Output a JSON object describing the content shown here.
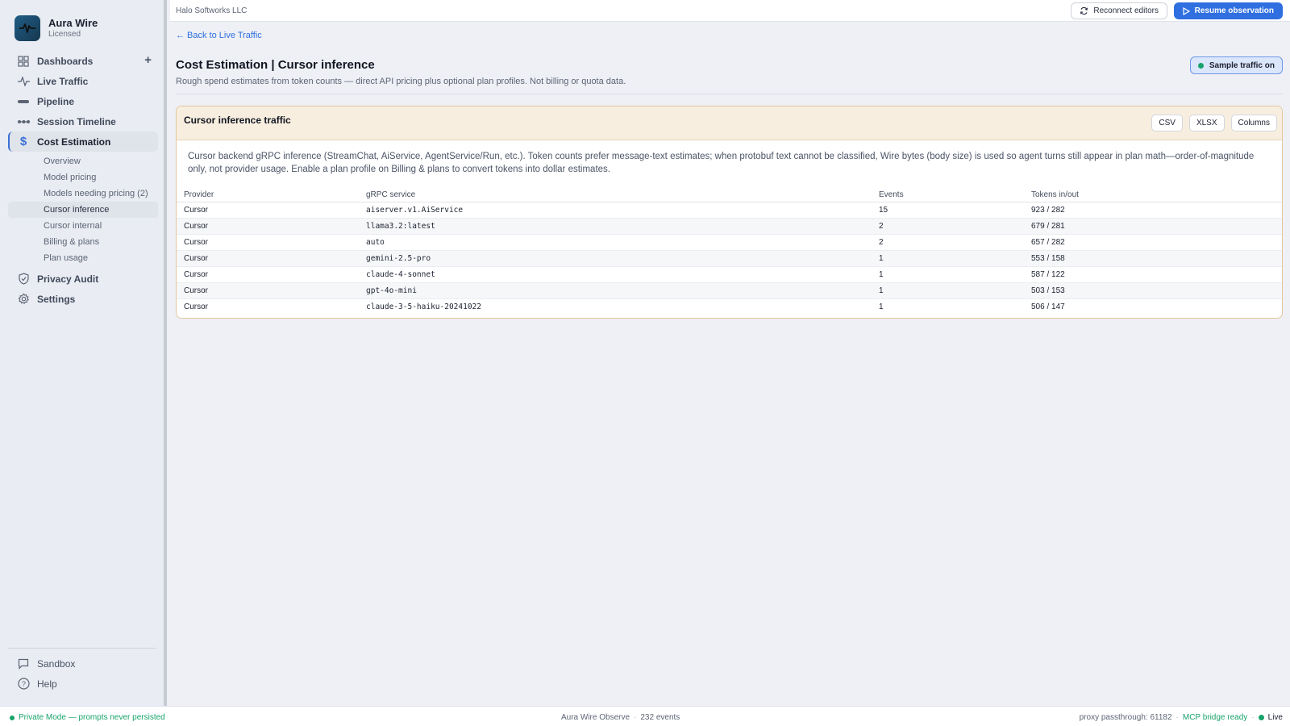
{
  "brand": {
    "name": "Aura Wire",
    "subtitle": "Licensed"
  },
  "sidebar": {
    "items": [
      {
        "label": "Dashboards",
        "icon": "grid-icon"
      },
      {
        "label": "Live Traffic",
        "icon": "activity-icon"
      },
      {
        "label": "Pipeline",
        "icon": "pipeline-icon"
      },
      {
        "label": "Session Timeline",
        "icon": "timeline-icon"
      },
      {
        "label": "Cost Estimation",
        "icon": "dollar-icon",
        "active": true
      },
      {
        "label": "Privacy Audit",
        "icon": "shield-icon"
      },
      {
        "label": "Settings",
        "icon": "gear-icon"
      }
    ],
    "cost_sub_items": [
      "Overview",
      "Model pricing",
      "Models needing pricing (2)",
      "Cursor inference",
      "Cursor internal",
      "Billing & plans",
      "Plan usage"
    ],
    "bottom_items": [
      {
        "label": "Sandbox",
        "icon": "chat-icon"
      },
      {
        "label": "Help",
        "icon": "help-icon"
      }
    ]
  },
  "topbar": {
    "org": "Halo Softworks LLC",
    "reconnect_label": "Reconnect editors",
    "resume_label": "Resume observation"
  },
  "page": {
    "back_link": "← Back to Live Traffic",
    "title": "Cost Estimation | Cursor inference",
    "subtitle": "Rough spend estimates from token counts — direct API pricing plus optional plan profiles. Not billing or quota data.",
    "sample_badge": "Sample traffic on"
  },
  "card": {
    "title": "Cursor inference traffic",
    "buttons": [
      "CSV",
      "XLSX",
      "Columns"
    ],
    "description": "Cursor backend gRPC inference (StreamChat, AiService, AgentService/Run, etc.). Token counts prefer message-text estimates; when protobuf text cannot be classified, Wire bytes (body size) is used so agent turns still appear in plan math—order-of-magnitude only, not provider usage. Enable a plan profile on Billing & plans to convert tokens into dollar estimates.",
    "columns": [
      "Provider",
      "gRPC service",
      "Events",
      "Tokens in/out"
    ],
    "rows": [
      [
        "Cursor",
        "aiserver.v1.AiService",
        "15",
        "923 / 282"
      ],
      [
        "Cursor",
        "llama3.2:latest",
        "2",
        "679 / 281"
      ],
      [
        "Cursor",
        "auto",
        "2",
        "657 / 282"
      ],
      [
        "Cursor",
        "gemini-2.5-pro",
        "1",
        "553 / 158"
      ],
      [
        "Cursor",
        "claude-4-sonnet",
        "1",
        "587 / 122"
      ],
      [
        "Cursor",
        "gpt-4o-mini",
        "1",
        "503 / 153"
      ],
      [
        "Cursor",
        "claude-3-5-haiku-20241022",
        "1",
        "506 / 147"
      ]
    ]
  },
  "statusbar": {
    "private_mode": "Private Mode — prompts never persisted",
    "app": "Aura Wire Observe",
    "events": "232 events",
    "proxy": "proxy passthrough: 61182",
    "mcp": "MCP bridge ready",
    "live": "Live"
  },
  "colors": {
    "accent": "#2f6fe0",
    "success": "#18a36a",
    "card_header": "#f8eedf"
  }
}
